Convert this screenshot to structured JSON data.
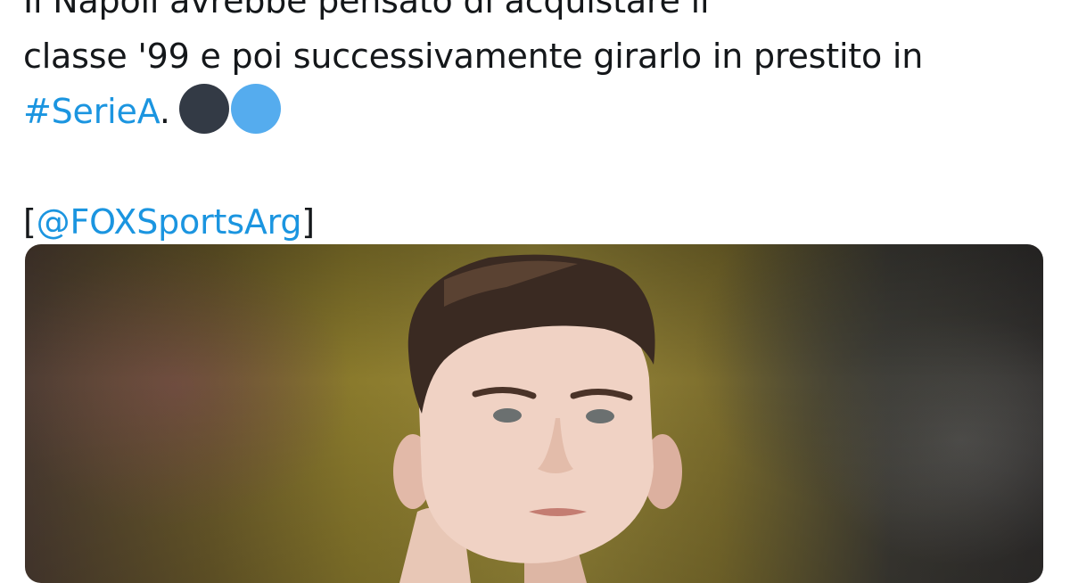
{
  "tweet": {
    "line_partial": "Il Napoli avrebbe pensato di acquistare il",
    "line1": "classe '99 e poi successivamente girarlo in prestito in",
    "hashtag": "#SerieA",
    "hashtag_suffix": ".",
    "emoji": [
      "dark-circle",
      "blue-circle"
    ],
    "credit_open": "[",
    "credit_handle": "@FOXSportsArg",
    "credit_close": "]"
  },
  "media": {
    "subject": "player-photo"
  },
  "colors": {
    "link": "#1b95e0",
    "text": "#14171a",
    "dark_circle": "#333a45",
    "blue_circle": "#55acee"
  }
}
